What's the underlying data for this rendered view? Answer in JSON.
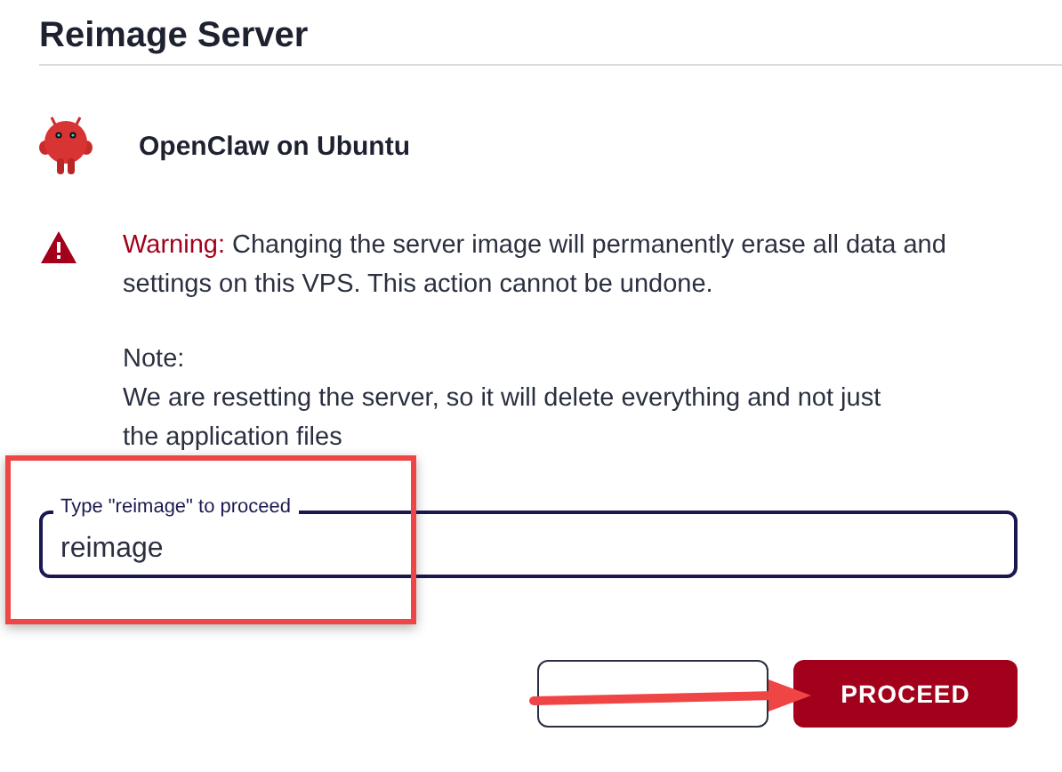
{
  "dialog": {
    "title": "Reimage Server"
  },
  "app": {
    "name": "OpenClaw on Ubuntu"
  },
  "warning": {
    "label": "Warning:",
    "text": "Changing the server image will permanently erase all data and settings on this VPS. This action cannot be undone."
  },
  "note": {
    "label": "Note:",
    "text": "We are resetting the server, so it will delete everything and not just the application files"
  },
  "field": {
    "label": "Type \"reimage\" to proceed",
    "value": "reimage",
    "focused": true
  },
  "buttons": [
    {
      "kind": "secondary"
    },
    {
      "label": "PROCEED",
      "kind": "primary"
    }
  ]
}
